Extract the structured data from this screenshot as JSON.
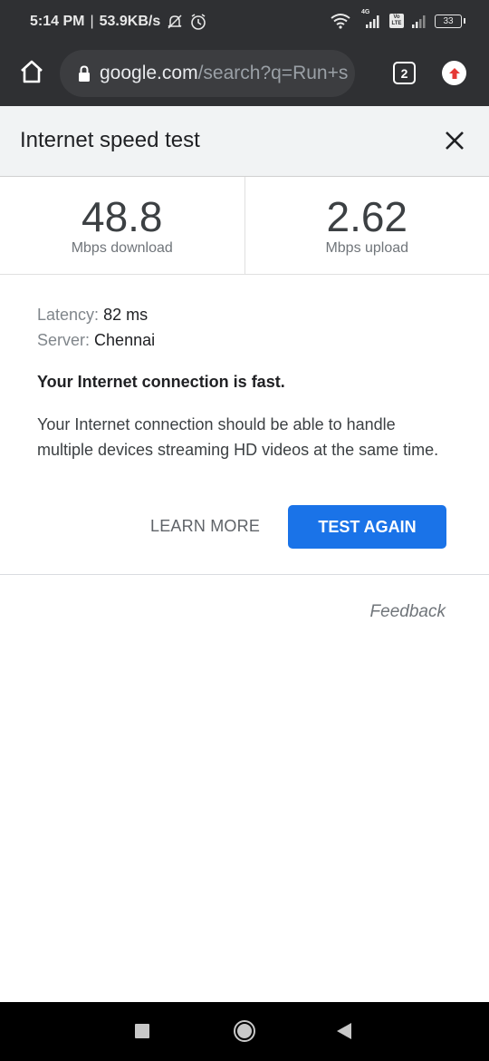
{
  "status_bar": {
    "time": "5:14 PM",
    "separator": "|",
    "net_speed": "53.9KB/s",
    "icons": [
      "mute-notifications-icon",
      "alarm-icon",
      "wifi-icon",
      "signal-4g-icon",
      "volte-icon",
      "signal-icon",
      "battery-icon"
    ],
    "network_type": "4G",
    "volte_label_top": "Vo",
    "volte_label_bottom": "LTE",
    "battery": "33"
  },
  "browser": {
    "url_host": "google.com",
    "url_path": "/search?q=Run+s",
    "tab_count": "2",
    "icons": [
      "home-icon",
      "lock-icon",
      "tab-switcher-icon",
      "update-icon"
    ]
  },
  "card": {
    "title": "Internet speed test",
    "close_icon": "close-icon",
    "download": {
      "value": "48.8",
      "label": "Mbps download"
    },
    "upload": {
      "value": "2.62",
      "label": "Mbps upload"
    },
    "latency": {
      "key": "Latency:",
      "value": "82 ms"
    },
    "server": {
      "key": "Server:",
      "value": "Chennai"
    },
    "verdict": "Your Internet connection is fast.",
    "description": "Your Internet connection should be able to handle multiple devices streaming HD videos at the same time.",
    "learn_more": "LEARN MORE",
    "test_again": "TEST AGAIN",
    "feedback": "Feedback"
  },
  "colors": {
    "accent": "#1a73e8",
    "chrome_dark": "#2f3033",
    "update_red": "#e53935"
  },
  "nav_bar": {
    "buttons": [
      "recents",
      "home",
      "back"
    ]
  }
}
